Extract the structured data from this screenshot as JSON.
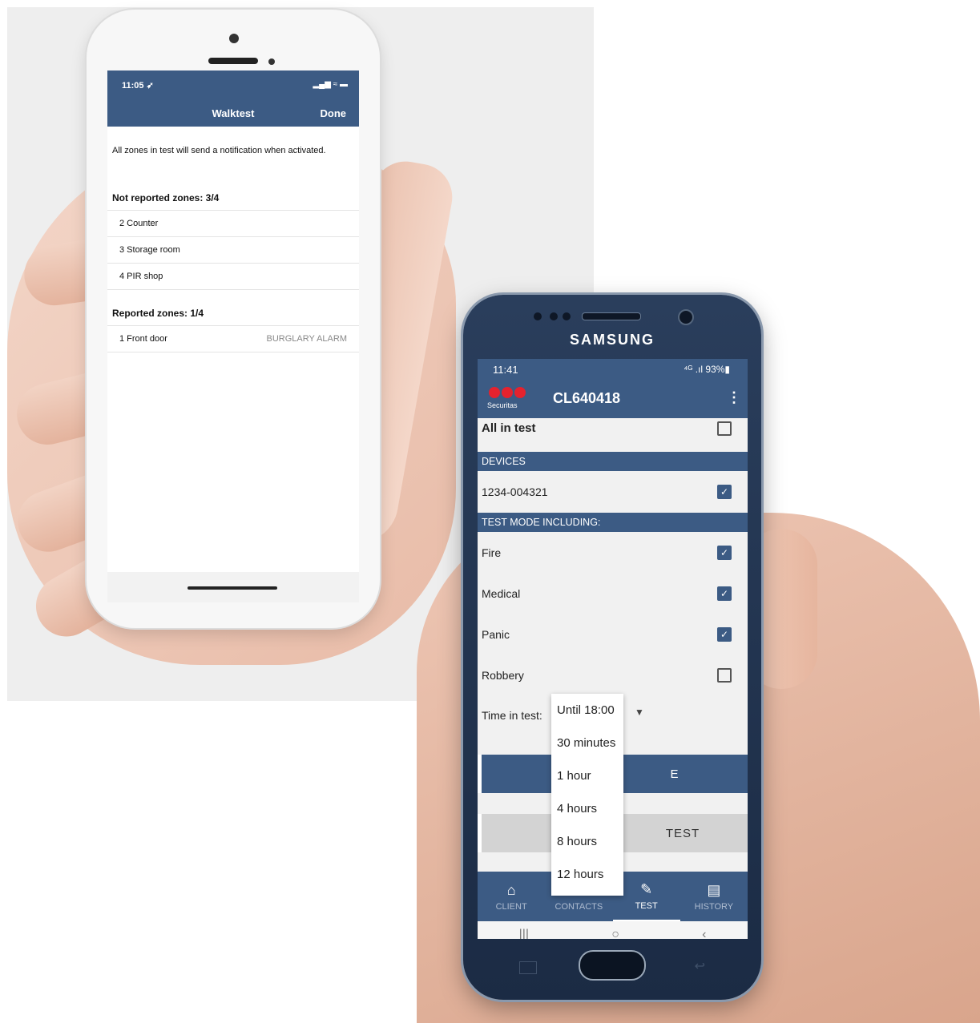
{
  "walktest": {
    "status_time": "11:05 ➶",
    "status_icons": "▂▄▆ ≈ ▬",
    "title": "Walktest",
    "done_label": "Done",
    "notice": "All zones in test will send a notification when activated.",
    "not_reported_title": "Not reported zones: 3/4",
    "not_reported": [
      "2 Counter",
      "3 Storage room",
      "4 PIR shop"
    ],
    "reported_title": "Reported zones: 1/4",
    "reported": [
      {
        "zone": "1 Front door",
        "status": "BURGLARY ALARM"
      }
    ]
  },
  "samsung": {
    "brand": "SAMSUNG",
    "status_time": "11:41",
    "status_right": "⁴ᴳ .ıl 93%▮",
    "logo_text": "Securitas",
    "client_id": "CL640418",
    "menu_icon": "⋮",
    "all_in_test_label": "All in test",
    "devices_header": "DEVICES",
    "device_id": "1234-004321",
    "test_mode_header": "TEST MODE INCLUDING:",
    "options": [
      {
        "label": "Fire",
        "checked": true
      },
      {
        "label": "Medical",
        "checked": true
      },
      {
        "label": "Panic",
        "checked": true
      },
      {
        "label": "Robbery",
        "checked": false
      }
    ],
    "time_in_test_label": "Time in test:",
    "button1_partial": "E",
    "button2_partial": "TEST",
    "dropdown_options": [
      "Until 18:00",
      "30 minutes",
      "1 hour",
      "4 hours",
      "8 hours",
      "12 hours"
    ],
    "nav": {
      "client": "CLIENT",
      "contacts": "CONTACTS",
      "test": "TEST",
      "history": "HISTORY"
    },
    "nav_icons": {
      "client": "⌂",
      "test": "✎",
      "history": "▤"
    },
    "sys": {
      "recent": "|||",
      "home": "○",
      "back": "‹"
    }
  }
}
